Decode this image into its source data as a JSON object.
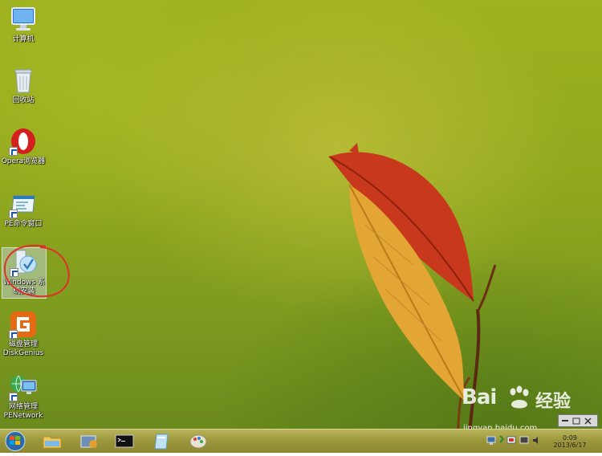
{
  "desktop": {
    "icons": [
      {
        "name": "computer-icon",
        "label": "计算机"
      },
      {
        "name": "recycle-bin-icon",
        "label": "回收站"
      },
      {
        "name": "opera-browser-icon",
        "label": "Opera浏览器"
      },
      {
        "name": "pe-command-window-icon",
        "label": "PE命令窗口"
      },
      {
        "name": "windows-install-icon",
        "label_line1": "Windows 系",
        "label_line2": "统安装"
      },
      {
        "name": "diskgenius-icon",
        "label_line1": "磁盘管理",
        "label_line2": "DiskGenius"
      },
      {
        "name": "pe-network-icon",
        "label_line1": "网络管理",
        "label_line2": "PENetwork"
      }
    ]
  },
  "taskbar": {
    "clock_time": "0:09",
    "clock_date": "2013/6/17"
  },
  "watermark": {
    "logo_text": "Bai",
    "logo_text2": "经验",
    "url": "jingyan.baidu.com"
  },
  "colors": {
    "annotation_circle": "#e0302a",
    "taskbar": "#9b963b"
  }
}
